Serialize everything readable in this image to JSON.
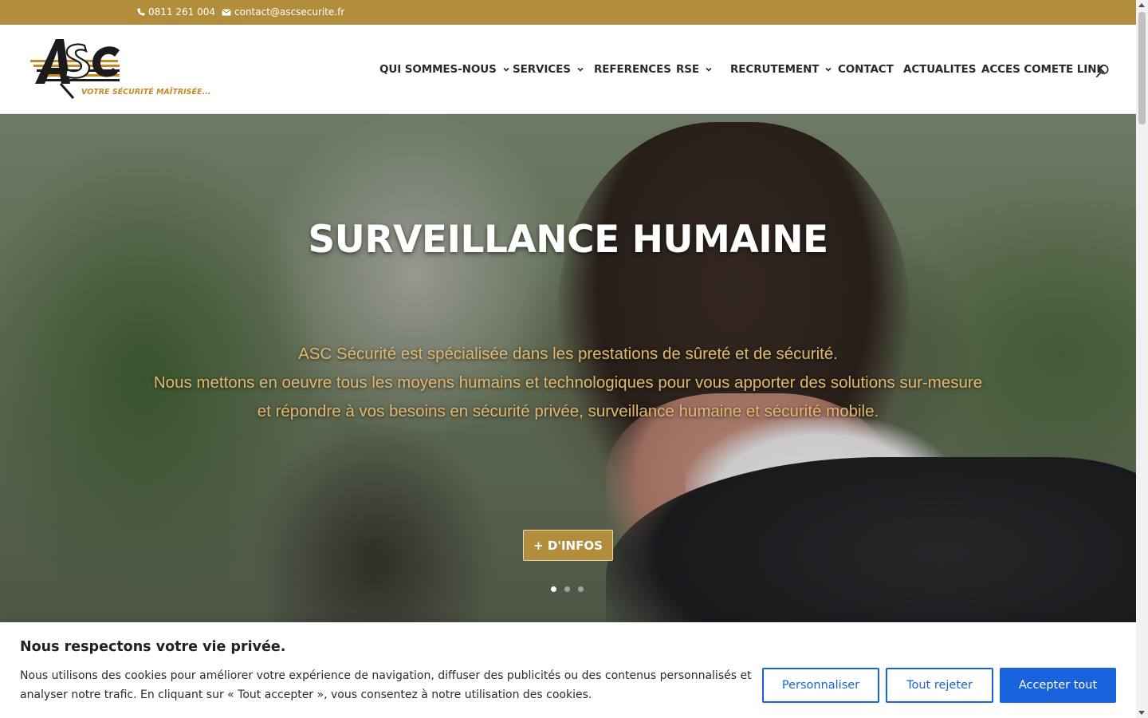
{
  "topbar": {
    "phone": "0811 261 004",
    "email": "contact@ascsecurite.fr",
    "phone_icon": "phone-icon",
    "email_icon": "envelope-icon",
    "background_color": "#b18d3c"
  },
  "header": {
    "logo_text": "ASC",
    "logo_tagline": "VOTRE SÉCURITÉ MAÎTRISÉE...",
    "nav": [
      {
        "label": "QUI SOMMES-NOUS",
        "has_dropdown": true
      },
      {
        "label": "SERVICES",
        "has_dropdown": true
      },
      {
        "label": "REFERENCES",
        "has_dropdown": false
      },
      {
        "label": "RSE",
        "has_dropdown": true
      },
      {
        "label": "RECRUTEMENT",
        "has_dropdown": true
      },
      {
        "label": "CONTACT",
        "has_dropdown": false
      },
      {
        "label": "ACTUALITES",
        "has_dropdown": false
      },
      {
        "label": "ACCES COMETE LINK",
        "has_dropdown": false
      }
    ],
    "search_icon": "search-icon"
  },
  "hero": {
    "title": "SURVEILLANCE HUMAINE",
    "text_line1": "ASC Sécurité est spécialisée dans les prestations de sûreté et de sécurité.",
    "text_line2": "Nous mettons en oeuvre tous les moyens humains et technologiques pour vous apporter des solutions sur-mesure et répondre à vos besoins en sécurité privée, surveillance humaine et sécurité mobile.",
    "button_label": "+ D'INFOS",
    "slide_count": 3,
    "active_slide": 1,
    "text_color": "#e2b86e"
  },
  "cookie": {
    "title": "Nous respectons votre vie privée.",
    "text": "Nous utilisons des cookies pour améliorer votre expérience de navigation, diffuser des publicités ou des contenus personnalisés et analyser notre trafic. En cliquant sur « Tout accepter », vous consentez à notre utilisation des cookies.",
    "btn_customize": "Personnaliser",
    "btn_reject": "Tout rejeter",
    "btn_accept": "Accepter tout",
    "accent_color": "#1863dc"
  }
}
